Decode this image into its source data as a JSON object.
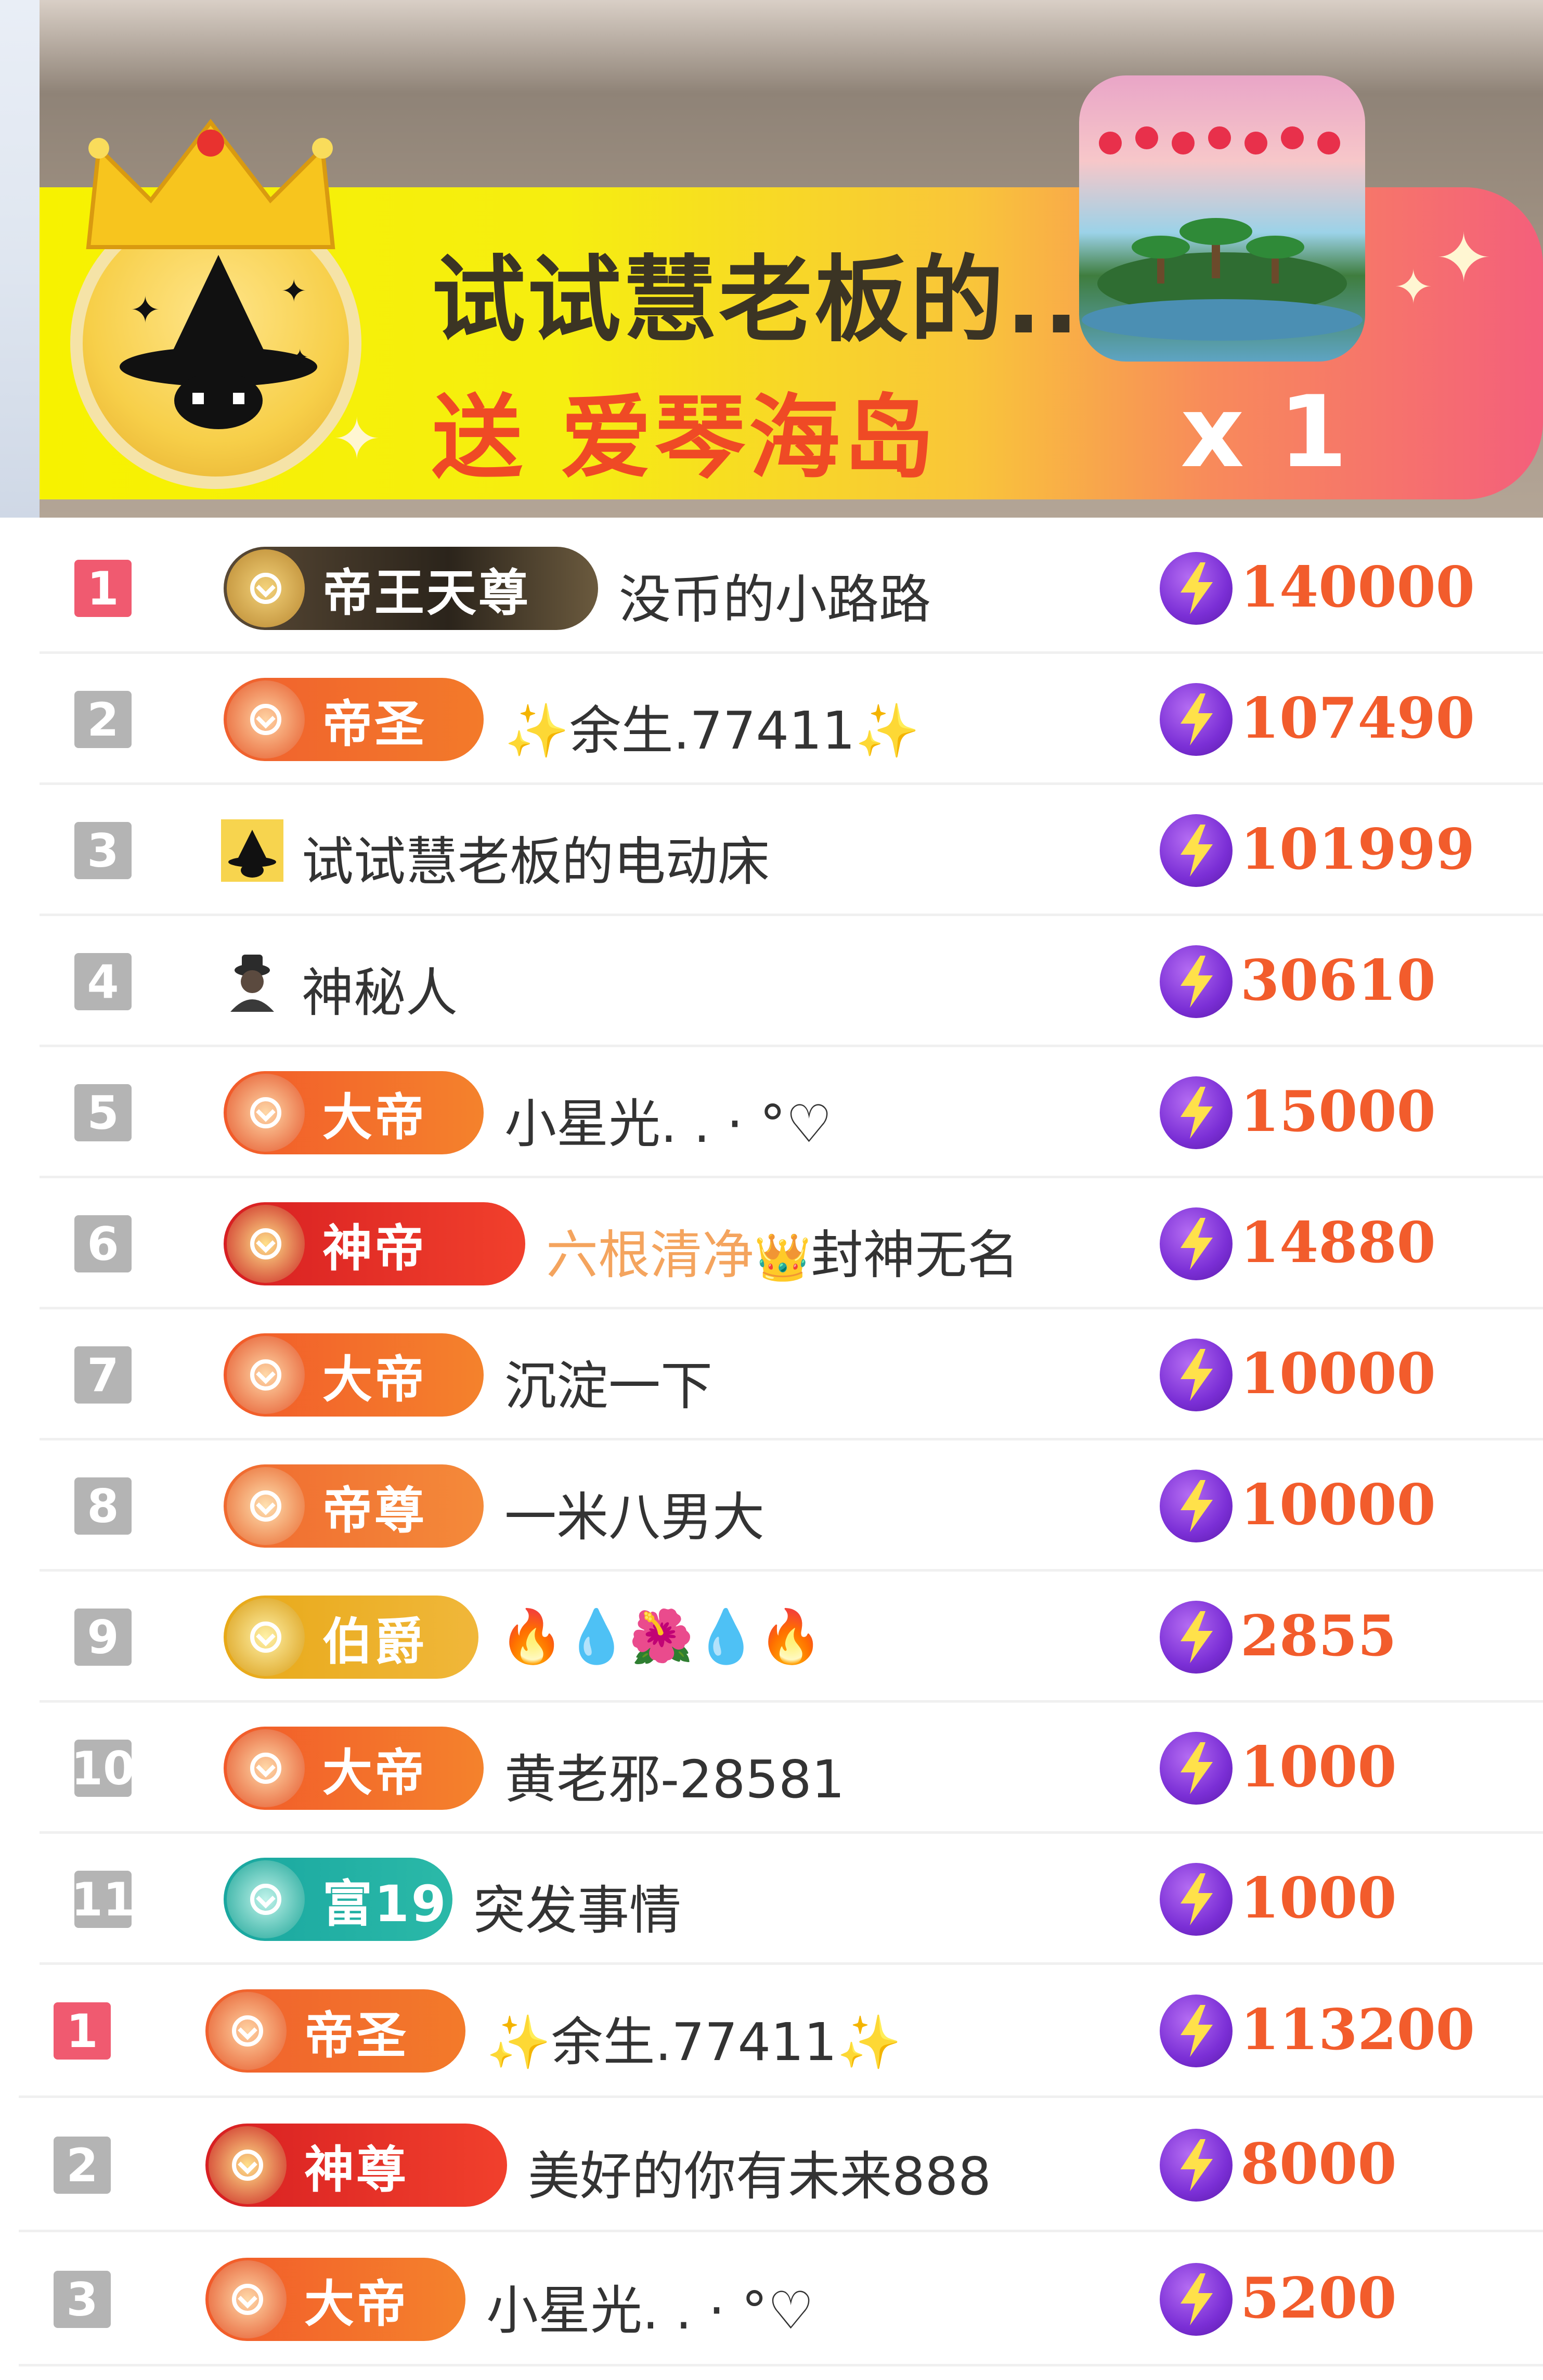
{
  "banner": {
    "line1": "试试慧老板的...",
    "line2": "送 爱琴海岛",
    "count": "x 1"
  },
  "colors": {
    "score": "#f25c2c",
    "rank_top": "#f05a70",
    "rank_default": "#b4b4b4"
  },
  "list1": [
    {
      "rank": "1",
      "badge": "帝王天尊",
      "name": "没币的小路路",
      "score": "140000"
    },
    {
      "rank": "2",
      "badge": "帝圣",
      "name": "✨余生.77411✨",
      "score": "107490"
    },
    {
      "rank": "3",
      "badge": "",
      "name": "试试慧老板的电动床",
      "score": "101999"
    },
    {
      "rank": "4",
      "badge": "",
      "name": "神秘人",
      "score": "30610"
    },
    {
      "rank": "5",
      "badge": "大帝",
      "name": "小星光. . · °♡",
      "score": "15000"
    },
    {
      "rank": "6",
      "badge": "神帝",
      "name_part1": "六根清净",
      "name_part2": "封神无名",
      "score": "14880"
    },
    {
      "rank": "7",
      "badge": "大帝",
      "name": "沉淀一下",
      "score": "10000"
    },
    {
      "rank": "8",
      "badge": "帝尊",
      "name": "一米八男大",
      "score": "10000"
    },
    {
      "rank": "9",
      "badge": "伯爵",
      "name": "🔥💧🌺💧🔥",
      "score": "2855"
    },
    {
      "rank": "10",
      "badge": "大帝",
      "name": "黄老邪-28581",
      "score": "1000"
    },
    {
      "rank": "11",
      "badge": "富19",
      "name": "突发事情",
      "score": "1000"
    }
  ],
  "list2": [
    {
      "rank": "1",
      "badge": "帝圣",
      "name": "✨余生.77411✨",
      "score": "113200"
    },
    {
      "rank": "2",
      "badge": "神尊",
      "name": "美好的你有未来888",
      "score": "8000"
    },
    {
      "rank": "3",
      "badge": "大帝",
      "name": "小星光. . · °♡",
      "score": "5200"
    }
  ]
}
